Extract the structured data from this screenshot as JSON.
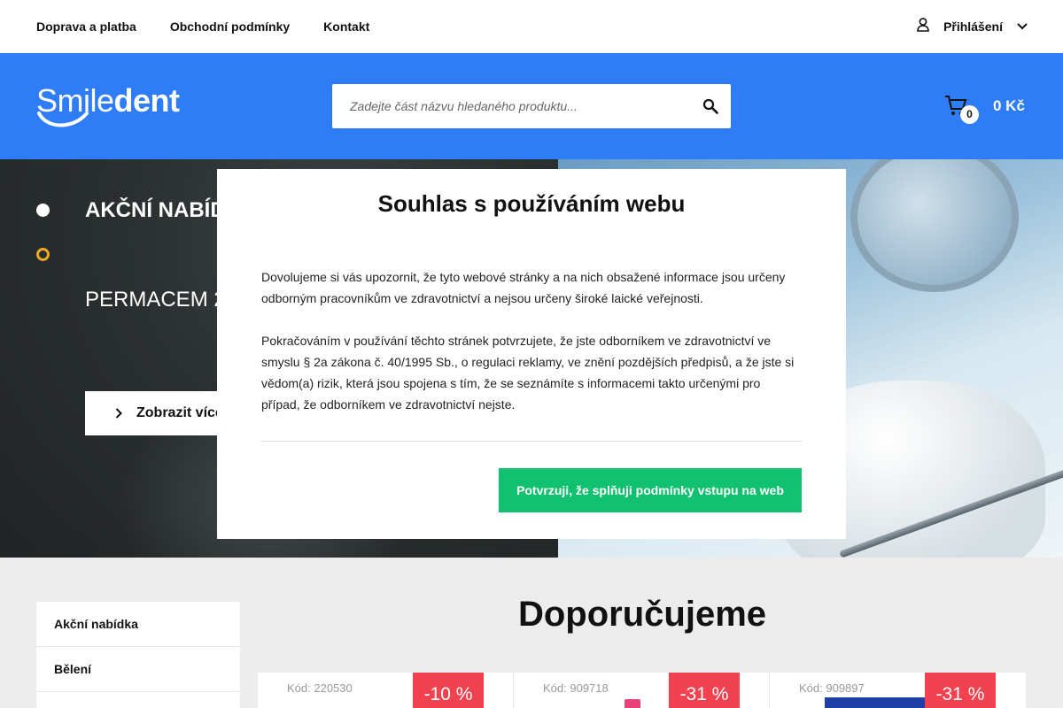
{
  "topnav": {
    "links": [
      "Doprava a platba",
      "Obchodní podmínky",
      "Kontakt"
    ],
    "login_label": "Přihlášení"
  },
  "header": {
    "logo_part1": "Smile",
    "logo_part2": "dent",
    "search_placeholder": "Zadejte část názvu hledaného produktu...",
    "cart_count": "0",
    "cart_total": "0 Kč"
  },
  "hero": {
    "title": "AKČNÍ NABÍDKA",
    "subtitle": "PERMACEM 2.0",
    "button_label": "Zobrazit více"
  },
  "modal": {
    "title": "Souhlas s používáním webu",
    "paragraph1": "Dovolujeme si vás upozornit, že tyto webové stránky a na nich obsažené informace jsou určeny odborným pracovníkům ve zdravotnictví a nejsou určeny široké laické veřejnosti.",
    "paragraph2": "Pokračováním v používání těchto stránek potvrzujete, že jste odborníkem ve zdravotnictví ve smyslu § 2a zákona č. 40/1995 Sb., o regulaci reklamy, ve znění pozdějších předpisů, a že jste si vědom(a) rizik, která jsou spojena s tím, že se seznámíte s informacemi takto určenými pro případ, že odborníkem ve zdravotnictví nejste.",
    "confirm_label": "Potvrzuji, že splňuji podmínky vstupu na web"
  },
  "sidebar": {
    "items": [
      "Akční nabídka",
      "Bělení"
    ]
  },
  "recommended": {
    "title": "Doporučujeme",
    "products": [
      {
        "code": "Kód: 220530",
        "discount": "-10 %"
      },
      {
        "code": "Kód: 909718",
        "discount": "-31 %"
      },
      {
        "code": "Kód: 909897",
        "discount": "-31 %"
      }
    ]
  },
  "colors": {
    "brand_blue": "#2f7df6",
    "confirm_green": "#12c16f",
    "discount_red": "#f2424f",
    "slider_dot_orange": "#f0a722"
  }
}
